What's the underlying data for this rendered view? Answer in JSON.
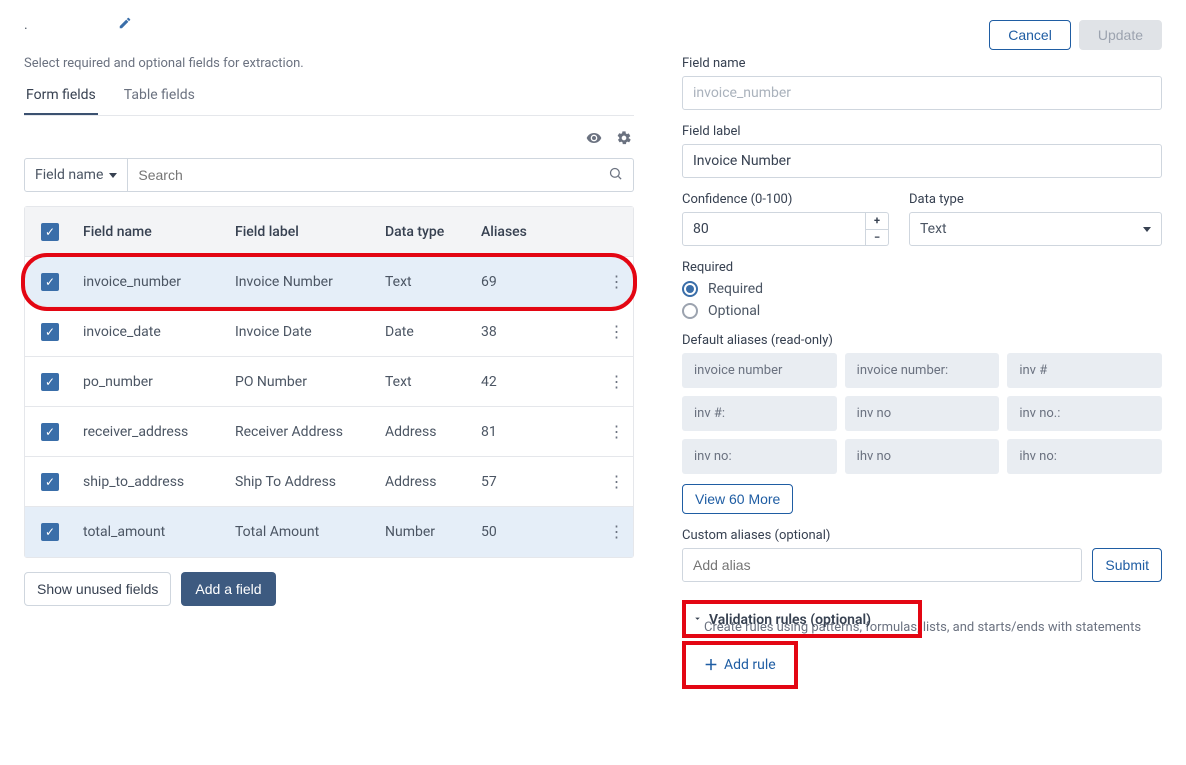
{
  "header": {
    "cancel": "Cancel",
    "update": "Update"
  },
  "subtitle": "Select required and optional fields for extraction.",
  "tabs": {
    "form": "Form fields",
    "table": "Table fields"
  },
  "filter": {
    "by": "Field name",
    "search_placeholder": "Search"
  },
  "table_headers": {
    "name": "Field name",
    "label": "Field label",
    "type": "Data type",
    "aliases": "Aliases"
  },
  "rows": [
    {
      "name": "invoice_number",
      "label": "Invoice Number",
      "type": "Text",
      "aliases": "69",
      "selected": true
    },
    {
      "name": "invoice_date",
      "label": "Invoice Date",
      "type": "Date",
      "aliases": "38",
      "selected": false
    },
    {
      "name": "po_number",
      "label": "PO Number",
      "type": "Text",
      "aliases": "42",
      "selected": false
    },
    {
      "name": "receiver_address",
      "label": "Receiver Address",
      "type": "Address",
      "aliases": "81",
      "selected": false
    },
    {
      "name": "ship_to_address",
      "label": "Ship To Address",
      "type": "Address",
      "aliases": "57",
      "selected": false
    },
    {
      "name": "total_amount",
      "label": "Total Amount",
      "type": "Number",
      "aliases": "50",
      "selected": true
    }
  ],
  "below_table": {
    "show_unused": "Show unused fields",
    "add_field": "Add a field"
  },
  "detail": {
    "field_name_label": "Field name",
    "field_name_value": "invoice_number",
    "field_label_label": "Field label",
    "field_label_value": "Invoice Number",
    "confidence_label": "Confidence (0-100)",
    "confidence_value": "80",
    "data_type_label": "Data type",
    "data_type_value": "Text",
    "required_label": "Required",
    "required_option": "Required",
    "optional_option": "Optional",
    "default_aliases_label": "Default aliases (read-only)",
    "aliases": [
      "invoice number",
      "invoice number:",
      "inv #",
      "inv #:",
      "inv no",
      "inv no.:",
      "inv no:",
      "ihv no",
      "ihv no:"
    ],
    "view_more": "View 60 More",
    "custom_aliases_label": "Custom aliases (optional)",
    "add_alias_placeholder": "Add alias",
    "submit": "Submit",
    "validation_title": "Validation rules (optional)",
    "validation_sub": "Create rules using patterns, formulas, lists, and starts/ends with statements",
    "add_rule": "Add rule"
  }
}
